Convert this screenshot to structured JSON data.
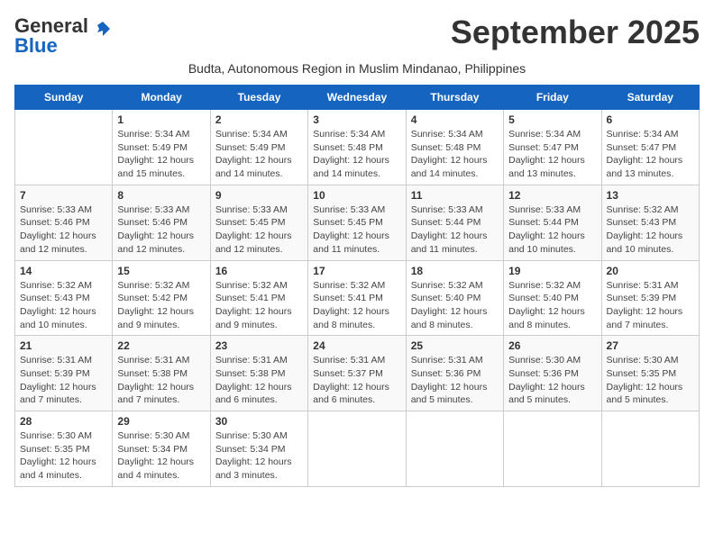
{
  "logo": {
    "text_general": "General",
    "text_blue": "Blue",
    "icon": "▶"
  },
  "title": "September 2025",
  "subtitle": "Budta, Autonomous Region in Muslim Mindanao, Philippines",
  "days_of_week": [
    "Sunday",
    "Monday",
    "Tuesday",
    "Wednesday",
    "Thursday",
    "Friday",
    "Saturday"
  ],
  "weeks": [
    [
      {
        "day": "",
        "sunrise": "",
        "sunset": "",
        "daylight": ""
      },
      {
        "day": "1",
        "sunrise": "Sunrise: 5:34 AM",
        "sunset": "Sunset: 5:49 PM",
        "daylight": "Daylight: 12 hours and 15 minutes."
      },
      {
        "day": "2",
        "sunrise": "Sunrise: 5:34 AM",
        "sunset": "Sunset: 5:49 PM",
        "daylight": "Daylight: 12 hours and 14 minutes."
      },
      {
        "day": "3",
        "sunrise": "Sunrise: 5:34 AM",
        "sunset": "Sunset: 5:48 PM",
        "daylight": "Daylight: 12 hours and 14 minutes."
      },
      {
        "day": "4",
        "sunrise": "Sunrise: 5:34 AM",
        "sunset": "Sunset: 5:48 PM",
        "daylight": "Daylight: 12 hours and 14 minutes."
      },
      {
        "day": "5",
        "sunrise": "Sunrise: 5:34 AM",
        "sunset": "Sunset: 5:47 PM",
        "daylight": "Daylight: 12 hours and 13 minutes."
      },
      {
        "day": "6",
        "sunrise": "Sunrise: 5:34 AM",
        "sunset": "Sunset: 5:47 PM",
        "daylight": "Daylight: 12 hours and 13 minutes."
      }
    ],
    [
      {
        "day": "7",
        "sunrise": "Sunrise: 5:33 AM",
        "sunset": "Sunset: 5:46 PM",
        "daylight": "Daylight: 12 hours and 12 minutes."
      },
      {
        "day": "8",
        "sunrise": "Sunrise: 5:33 AM",
        "sunset": "Sunset: 5:46 PM",
        "daylight": "Daylight: 12 hours and 12 minutes."
      },
      {
        "day": "9",
        "sunrise": "Sunrise: 5:33 AM",
        "sunset": "Sunset: 5:45 PM",
        "daylight": "Daylight: 12 hours and 12 minutes."
      },
      {
        "day": "10",
        "sunrise": "Sunrise: 5:33 AM",
        "sunset": "Sunset: 5:45 PM",
        "daylight": "Daylight: 12 hours and 11 minutes."
      },
      {
        "day": "11",
        "sunrise": "Sunrise: 5:33 AM",
        "sunset": "Sunset: 5:44 PM",
        "daylight": "Daylight: 12 hours and 11 minutes."
      },
      {
        "day": "12",
        "sunrise": "Sunrise: 5:33 AM",
        "sunset": "Sunset: 5:44 PM",
        "daylight": "Daylight: 12 hours and 10 minutes."
      },
      {
        "day": "13",
        "sunrise": "Sunrise: 5:32 AM",
        "sunset": "Sunset: 5:43 PM",
        "daylight": "Daylight: 12 hours and 10 minutes."
      }
    ],
    [
      {
        "day": "14",
        "sunrise": "Sunrise: 5:32 AM",
        "sunset": "Sunset: 5:43 PM",
        "daylight": "Daylight: 12 hours and 10 minutes."
      },
      {
        "day": "15",
        "sunrise": "Sunrise: 5:32 AM",
        "sunset": "Sunset: 5:42 PM",
        "daylight": "Daylight: 12 hours and 9 minutes."
      },
      {
        "day": "16",
        "sunrise": "Sunrise: 5:32 AM",
        "sunset": "Sunset: 5:41 PM",
        "daylight": "Daylight: 12 hours and 9 minutes."
      },
      {
        "day": "17",
        "sunrise": "Sunrise: 5:32 AM",
        "sunset": "Sunset: 5:41 PM",
        "daylight": "Daylight: 12 hours and 8 minutes."
      },
      {
        "day": "18",
        "sunrise": "Sunrise: 5:32 AM",
        "sunset": "Sunset: 5:40 PM",
        "daylight": "Daylight: 12 hours and 8 minutes."
      },
      {
        "day": "19",
        "sunrise": "Sunrise: 5:32 AM",
        "sunset": "Sunset: 5:40 PM",
        "daylight": "Daylight: 12 hours and 8 minutes."
      },
      {
        "day": "20",
        "sunrise": "Sunrise: 5:31 AM",
        "sunset": "Sunset: 5:39 PM",
        "daylight": "Daylight: 12 hours and 7 minutes."
      }
    ],
    [
      {
        "day": "21",
        "sunrise": "Sunrise: 5:31 AM",
        "sunset": "Sunset: 5:39 PM",
        "daylight": "Daylight: 12 hours and 7 minutes."
      },
      {
        "day": "22",
        "sunrise": "Sunrise: 5:31 AM",
        "sunset": "Sunset: 5:38 PM",
        "daylight": "Daylight: 12 hours and 7 minutes."
      },
      {
        "day": "23",
        "sunrise": "Sunrise: 5:31 AM",
        "sunset": "Sunset: 5:38 PM",
        "daylight": "Daylight: 12 hours and 6 minutes."
      },
      {
        "day": "24",
        "sunrise": "Sunrise: 5:31 AM",
        "sunset": "Sunset: 5:37 PM",
        "daylight": "Daylight: 12 hours and 6 minutes."
      },
      {
        "day": "25",
        "sunrise": "Sunrise: 5:31 AM",
        "sunset": "Sunset: 5:36 PM",
        "daylight": "Daylight: 12 hours and 5 minutes."
      },
      {
        "day": "26",
        "sunrise": "Sunrise: 5:30 AM",
        "sunset": "Sunset: 5:36 PM",
        "daylight": "Daylight: 12 hours and 5 minutes."
      },
      {
        "day": "27",
        "sunrise": "Sunrise: 5:30 AM",
        "sunset": "Sunset: 5:35 PM",
        "daylight": "Daylight: 12 hours and 5 minutes."
      }
    ],
    [
      {
        "day": "28",
        "sunrise": "Sunrise: 5:30 AM",
        "sunset": "Sunset: 5:35 PM",
        "daylight": "Daylight: 12 hours and 4 minutes."
      },
      {
        "day": "29",
        "sunrise": "Sunrise: 5:30 AM",
        "sunset": "Sunset: 5:34 PM",
        "daylight": "Daylight: 12 hours and 4 minutes."
      },
      {
        "day": "30",
        "sunrise": "Sunrise: 5:30 AM",
        "sunset": "Sunset: 5:34 PM",
        "daylight": "Daylight: 12 hours and 3 minutes."
      },
      {
        "day": "",
        "sunrise": "",
        "sunset": "",
        "daylight": ""
      },
      {
        "day": "",
        "sunrise": "",
        "sunset": "",
        "daylight": ""
      },
      {
        "day": "",
        "sunrise": "",
        "sunset": "",
        "daylight": ""
      },
      {
        "day": "",
        "sunrise": "",
        "sunset": "",
        "daylight": ""
      }
    ]
  ]
}
